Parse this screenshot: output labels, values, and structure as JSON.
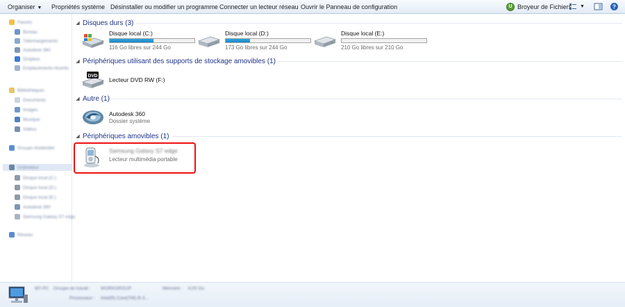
{
  "toolbar": {
    "organize": "Organiser",
    "system_properties": "Propriétés système",
    "uninstall": "Désinstaller ou modifier un programme",
    "map_drive": "Connecter un lecteur réseau",
    "control_panel": "Ouvrir le Panneau de configuration",
    "app_badge": "U",
    "app_name": "Broyeur de Fichiers"
  },
  "sidebar": {
    "items": [
      {
        "label": "Favoris"
      },
      {
        "label": "Bureau"
      },
      {
        "label": "Téléchargements"
      },
      {
        "label": "Autodesk 360"
      },
      {
        "label": "Dropbox"
      },
      {
        "label": "Emplacements récents"
      },
      {
        "label": "Bibliothèques"
      },
      {
        "label": "Documents"
      },
      {
        "label": "Images"
      },
      {
        "label": "Musique"
      },
      {
        "label": "Vidéos"
      },
      {
        "label": "Groupe résidentiel"
      },
      {
        "label": "Ordinateur"
      },
      {
        "label": "Disque local (C:)"
      },
      {
        "label": "Disque local (D:)"
      },
      {
        "label": "Disque local (E:)"
      },
      {
        "label": "Autodesk 360"
      },
      {
        "label": "Samsung Galaxy S7 edge"
      },
      {
        "label": "Réseau"
      }
    ]
  },
  "groups": {
    "hdd": "Disques durs (3)",
    "removable_storage": "Périphériques utilisant des supports de stockage amovibles (1)",
    "other": "Autre (1)",
    "removable_devices": "Périphériques amovibles (1)"
  },
  "drives": [
    {
      "name": "Disque local (C:)",
      "free": "116 Go libres sur 244 Go",
      "used_fraction": 0.52
    },
    {
      "name": "Disque local (D:)",
      "free": "173 Go libres sur 244 Go",
      "used_fraction": 0.29
    },
    {
      "name": "Disque local (E:)",
      "free": "210 Go libres sur 210 Go",
      "used_fraction": 0.0
    }
  ],
  "dvd": {
    "name": "Lecteur DVD RW (F:)",
    "badge": "DVD"
  },
  "autodesk": {
    "name": "Autodesk 360",
    "sub": "Dossier système"
  },
  "device": {
    "name": "Samsung Galaxy S7 edge",
    "sub": "Lecteur multimédia portable"
  },
  "details": {
    "pc_name": "MY-PC",
    "workgroup_label": "Groupe de travail :",
    "workgroup_value": "WORKGROUP",
    "memory_label": "Mémoire :",
    "memory_value": "8,00 Go",
    "processor_label": "Processeur :",
    "processor_value": "Intel(R) Core(TM) i5-3..."
  },
  "colors": {
    "accent": "#1e3287",
    "highlight": "#ee1111",
    "bar_fill": "#26a0da"
  }
}
